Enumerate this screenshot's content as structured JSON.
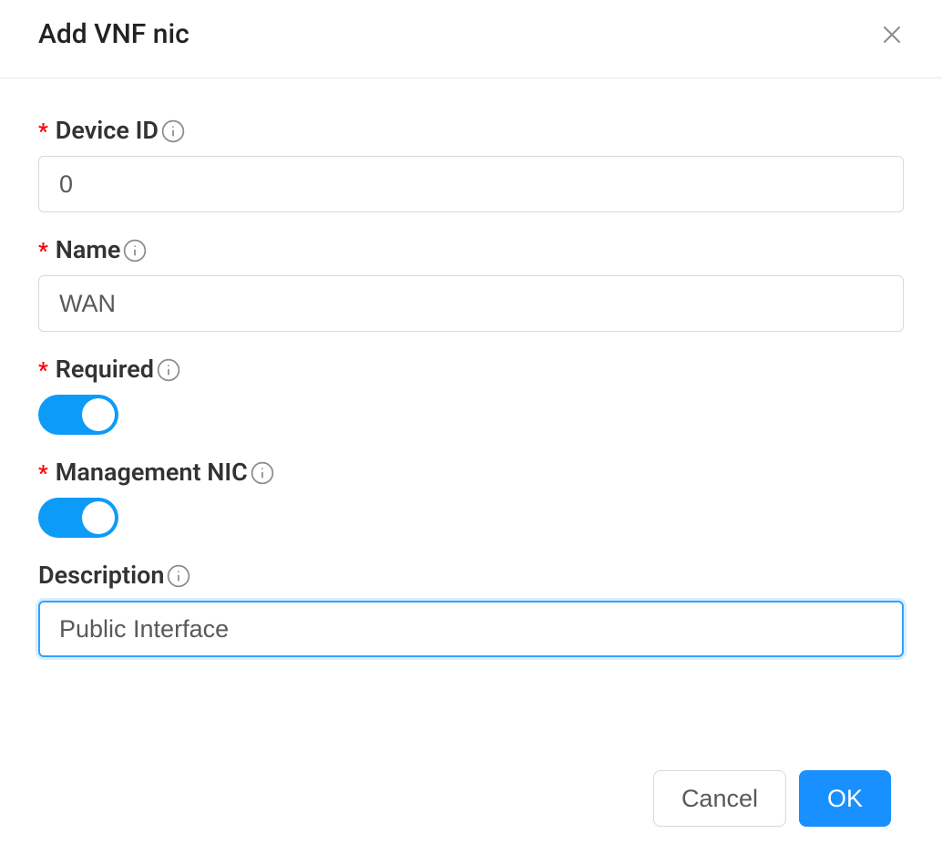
{
  "modal": {
    "title": "Add VNF nic"
  },
  "form": {
    "deviceId": {
      "label": "Device ID",
      "value": "0",
      "required": true
    },
    "name": {
      "label": "Name",
      "value": "WAN",
      "required": true
    },
    "required": {
      "label": "Required",
      "on": true,
      "required": true
    },
    "managementNic": {
      "label": "Management NIC",
      "on": true,
      "required": true
    },
    "description": {
      "label": "Description",
      "value": "Public Interface",
      "required": false
    }
  },
  "footer": {
    "cancel": "Cancel",
    "ok": "OK"
  }
}
